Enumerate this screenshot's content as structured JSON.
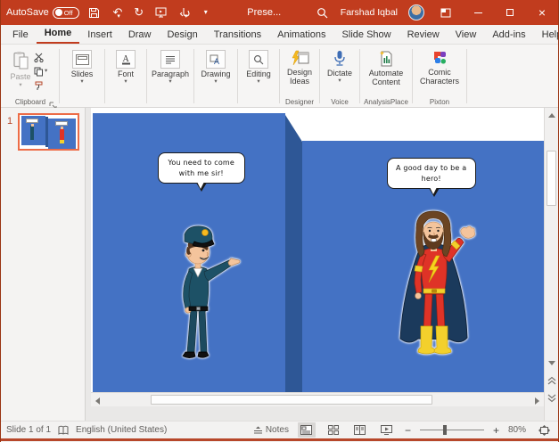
{
  "window": {
    "autosave_label": "AutoSave",
    "autosave_state": "Off",
    "title": "Prese...",
    "user_name": "Farshad Iqbal"
  },
  "icons": {
    "dropdown": "▾",
    "undo": "↶",
    "redo": "↻",
    "close": "×",
    "zoom_out": "−",
    "zoom_in": "+"
  },
  "ribbon_tabs": [
    "File",
    "Home",
    "Insert",
    "Draw",
    "Design",
    "Transitions",
    "Animations",
    "Slide Show",
    "Review",
    "View",
    "Add-ins",
    "Help"
  ],
  "ribbon": {
    "paste_label": "Paste",
    "slides_label": "Slides",
    "font_label": "Font",
    "paragraph_label": "Paragraph",
    "drawing_label": "Drawing",
    "editing_label": "Editing",
    "design_ideas_label": "Design Ideas",
    "dictate_label": "Dictate",
    "automate_content_label": "Automate Content",
    "comic_characters_label": "Comic Characters",
    "group_clipboard": "Clipboard",
    "group_designer": "Designer",
    "group_voice": "Voice",
    "group_analysisplace": "AnalysisPlace",
    "group_pixton": "Pixton"
  },
  "slides_panel": {
    "slide_number": "1"
  },
  "slide": {
    "left_bubble_text": "You need to come with me sir!",
    "right_bubble_text": "A good day to be a hero!"
  },
  "status_bar": {
    "slide_counter": "Slide 1 of 1",
    "language": "English (United States)",
    "notes_label": "Notes",
    "zoom_level": "80%"
  },
  "colors": {
    "accent": "#C13C1E",
    "thumbnail_selection": "#ED6C47",
    "panel_blue": "#4472C4",
    "fold_blue": "#2E5796",
    "fold_shadow": "#203E6E",
    "police_uniform": "#1D5166",
    "hero_suit_red": "#DF3327",
    "hero_yellow": "#F3D02C",
    "cape_navy": "#1B3A5C"
  }
}
